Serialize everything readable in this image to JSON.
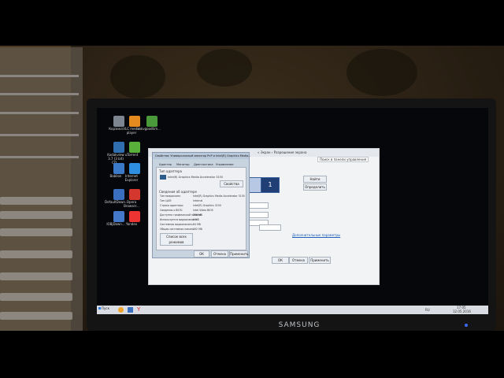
{
  "photo": {
    "monitor_brand": "SAMSUNG",
    "desktop_icons": [
      {
        "label": "Корзина",
        "color": "#7c8590",
        "icon": "recycle-bin-icon"
      },
      {
        "label": "VLC media player",
        "color": "#e58a1f",
        "icon": "vlc-icon"
      },
      {
        "label": "mkvgoodtim...",
        "color": "#4a9a3b",
        "icon": "app-icon"
      },
      {
        "label": "Kodakview 3.7 (3 bit) CD...",
        "color": "#2f6fb0",
        "icon": "app-icon"
      },
      {
        "label": "uTorrent",
        "color": "#58b03a",
        "icon": "utorrent-icon"
      },
      {
        "label": "Babilon",
        "color": "#3a7ac9",
        "icon": "app-icon"
      },
      {
        "label": "Internet Explorer",
        "color": "#2e8fe0",
        "icon": "internet-explorer-icon"
      },
      {
        "label": "DefaultDown...",
        "color": "#3a6fc0",
        "icon": "app-icon"
      },
      {
        "label": "Opera Browser...",
        "color": "#d4372d",
        "icon": "opera-icon"
      },
      {
        "label": "IOBjDown...",
        "color": "#4478c8",
        "icon": "app-icon"
      },
      {
        "label": "Yandex",
        "color": "#e33",
        "icon": "yandex-icon"
      }
    ],
    "back_window": {
      "breadcrumb": "« Экран › Разрешение экрана",
      "search_placeholder": "Поиск в панели управления",
      "monitor_number": "1",
      "detect_button": "Найти",
      "identify_button": "Определить",
      "advanced_link": "Дополнительные параметры",
      "ok_button": "ОК",
      "cancel_button": "Отмена",
      "apply_button": "Применить"
    },
    "front_dialog": {
      "title": "Свойства: Универсальный монитор PnP и Intel(R) Graphics Media...",
      "tabs": [
        "Адаптер",
        "Монитор",
        "Диагностика",
        "Управление цветом"
      ],
      "adapter_type_header": "Тип адаптера",
      "adapter_name": "Intel(R) Graphics Media Accelerator 3150",
      "properties_button": "Свойства",
      "info_header": "Сведения об адаптере",
      "info_rows": [
        [
          "Тип микросхем:",
          "Intel(R) Graphics Media Accelerator 3150"
        ],
        [
          "Тип ЦАП:",
          "Internal"
        ],
        [
          "Строка адаптера:",
          "Intel(R) Graphics 3150"
        ],
        [
          "Сведения о BIOS:",
          "Intel Video BIOS"
        ]
      ],
      "memory_rows": [
        [
          "Доступно графической памяти:",
          "256 МБ"
        ],
        [
          "Используется видеопамяти:",
          "0 МБ"
        ],
        [
          "Системная видеопамять:",
          "64 МБ"
        ],
        [
          "Общая системная память:",
          "192 МБ"
        ]
      ],
      "modes_button": "Список всех режимов",
      "ok_button": "ОК",
      "cancel_button": "Отмена",
      "apply_button": "Применить"
    },
    "taskbar": {
      "start_label": "Пуск",
      "language": "RU",
      "time": "17:05",
      "date": "12.05.2016"
    }
  }
}
